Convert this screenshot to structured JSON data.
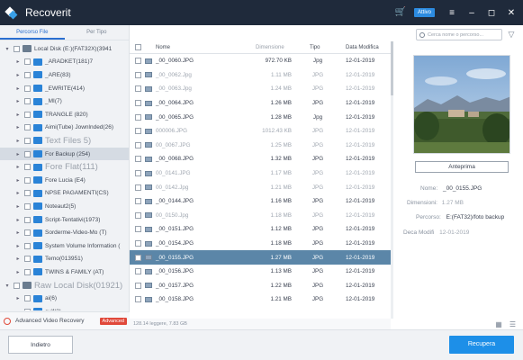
{
  "app": {
    "title": "Recoverit",
    "activate_label": "Attivo"
  },
  "sidebar": {
    "tabs": [
      "Percorso File",
      "Per Tipo"
    ],
    "tree": [
      {
        "label": "Local Disk (E:)(FAT32X)(3941",
        "indent": 0,
        "type": "disk",
        "expanded": true,
        "big": false
      },
      {
        "label": "_ARADKET(181)7",
        "indent": 1,
        "type": "folder",
        "expanded": false,
        "big": false
      },
      {
        "label": "_ARE(83)",
        "indent": 1,
        "type": "folder",
        "expanded": false,
        "big": false
      },
      {
        "label": "_EWRITE(414)",
        "indent": 1,
        "type": "folder",
        "expanded": false,
        "big": false
      },
      {
        "label": "_MI(7)",
        "indent": 1,
        "type": "folder",
        "expanded": false,
        "big": false
      },
      {
        "label": "TRANGLE (820)",
        "indent": 1,
        "type": "folder",
        "expanded": false,
        "big": false
      },
      {
        "label": "Aimi(Tube) Jownlnded(26)",
        "indent": 1,
        "type": "folder",
        "expanded": false,
        "big": false
      },
      {
        "label": "Text Files 5)",
        "indent": 1,
        "type": "folder",
        "expanded": false,
        "big": true
      },
      {
        "label": "For Backup (254)",
        "indent": 1,
        "type": "folder",
        "expanded": false,
        "big": false,
        "selected": true
      },
      {
        "label": "Fore Flat(111)",
        "indent": 1,
        "type": "folder",
        "expanded": false,
        "big": true
      },
      {
        "label": "Fore Lucia (E4)",
        "indent": 1,
        "type": "folder",
        "expanded": false,
        "big": false
      },
      {
        "label": "NPSE PAGAMENTI(CS)",
        "indent": 1,
        "type": "folder",
        "expanded": false,
        "big": false
      },
      {
        "label": "Noteaut2(5)",
        "indent": 1,
        "type": "folder",
        "expanded": false,
        "big": false
      },
      {
        "label": "Script-Tentativi(1973)",
        "indent": 1,
        "type": "folder",
        "expanded": false,
        "big": false
      },
      {
        "label": "Sorderme-Video-Mo (T)",
        "indent": 1,
        "type": "folder",
        "expanded": false,
        "big": false
      },
      {
        "label": "System Volume Information (",
        "indent": 1,
        "type": "folder",
        "expanded": false,
        "big": false
      },
      {
        "label": "Temo(013951)",
        "indent": 1,
        "type": "folder",
        "expanded": false,
        "big": false
      },
      {
        "label": "TWINS & FAMILY (AT)",
        "indent": 1,
        "type": "folder",
        "expanded": false,
        "big": false
      },
      {
        "label": "Raw Local Disk(01921)",
        "indent": 0,
        "type": "disk",
        "expanded": true,
        "big": true
      },
      {
        "label": "ai(6)",
        "indent": 1,
        "type": "folder",
        "expanded": false,
        "big": false
      },
      {
        "label": "avif(2)",
        "indent": 1,
        "type": "folder",
        "expanded": false,
        "big": false
      }
    ],
    "advanced": {
      "label": "Advanced Video Recovery",
      "badge": "Advanced"
    }
  },
  "search": {
    "placeholder": "Cerca nome o percorso..."
  },
  "table": {
    "headers": {
      "name": "Nome",
      "size": "Dimensione",
      "type": "Tipo",
      "date": "Data Modifica"
    },
    "rows": [
      {
        "name": "_00_0060.JPG",
        "size": "972.70 KB",
        "type": "Jpg",
        "date": "12-01-2019",
        "faded": false
      },
      {
        "name": "_00_0062.Jpg",
        "size": "1.11 MB",
        "type": "JPG",
        "date": "12-01-2019",
        "faded": true
      },
      {
        "name": "_00_0063.Jpg",
        "size": "1.24 MB",
        "type": "JPG",
        "date": "12-01-2019",
        "faded": true
      },
      {
        "name": "_00_0064.JPG",
        "size": "1.26 MB",
        "type": "JPG",
        "date": "12-01-2019",
        "faded": false
      },
      {
        "name": "_00_0065.JPG",
        "size": "1.28 MB",
        "type": "Jpg",
        "date": "12-01-2019",
        "faded": false
      },
      {
        "name": "000006.JPG",
        "size": "1012.43 KB",
        "type": "JPG",
        "date": "12-01-2019",
        "faded": true
      },
      {
        "name": "00_0067.JPG",
        "size": "1.25 MB",
        "type": "JPG",
        "date": "12-01-2019",
        "faded": true
      },
      {
        "name": "_00_0068.JPG",
        "size": "1.32 MB",
        "type": "JPG",
        "date": "12-01-2019",
        "faded": false
      },
      {
        "name": "00_0141.JPG",
        "size": "1.17 MB",
        "type": "JPG",
        "date": "12-01-2019",
        "faded": true
      },
      {
        "name": "00_0142.Jpg",
        "size": "1.21 MB",
        "type": "JPG",
        "date": "12-01-2019",
        "faded": true
      },
      {
        "name": "_00_0144.JPG",
        "size": "1.16 MB",
        "type": "JPG",
        "date": "12-01-2019",
        "faded": false
      },
      {
        "name": "00_0150.Jpg",
        "size": "1.18 MB",
        "type": "JPG",
        "date": "12-01-2019",
        "faded": true
      },
      {
        "name": "_00_0151.JPG",
        "size": "1.12 MB",
        "type": "JPG",
        "date": "12-01-2019",
        "faded": false
      },
      {
        "name": "_00_0154.JPG",
        "size": "1.18 MB",
        "type": "JPG",
        "date": "12-01-2019",
        "faded": false
      },
      {
        "name": "_00_0155.JPG",
        "size": "1.27 MB",
        "type": "JPG",
        "date": "12-01-2019",
        "faded": false,
        "selected": true
      },
      {
        "name": "_00_0156.JPG",
        "size": "1.13 MB",
        "type": "JPG",
        "date": "12-01-2019",
        "faded": false
      },
      {
        "name": "_00_0157.JPG",
        "size": "1.22 MB",
        "type": "JPG",
        "date": "12-01-2019",
        "faded": false
      },
      {
        "name": "_00_0158.JPG",
        "size": "1.21 MB",
        "type": "JPG",
        "date": "12-01-2019",
        "faded": false
      }
    ],
    "status": "128.14 leggere, 7.83 GB"
  },
  "preview": {
    "button_label": "Anteprima",
    "name_label": "Nome:",
    "name_value": "_00_0155.JPG",
    "size_label": "Dimensioni:",
    "size_value": "1.27 MB",
    "path_label": "Percorso:",
    "path_value": "E:(FAT32)/foto backup",
    "date_label": "Deca Modifi",
    "date_value": "12-01-2019"
  },
  "bottom": {
    "back_label": "Indietro",
    "recover_label": "Recupera"
  }
}
